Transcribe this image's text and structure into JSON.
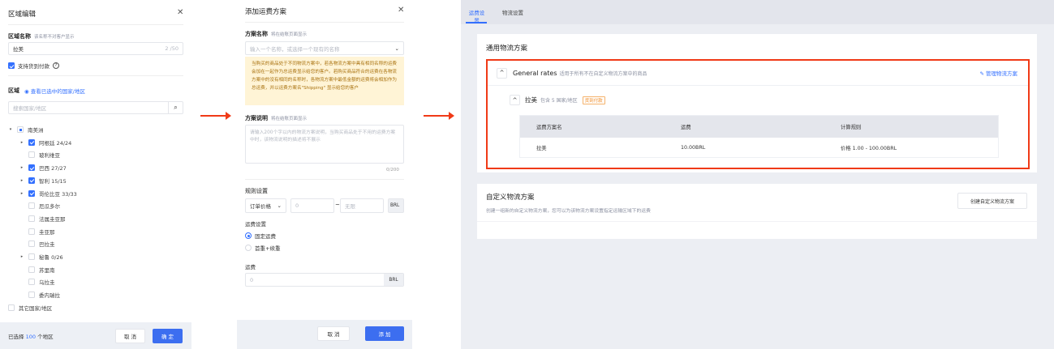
{
  "region_editor": {
    "title": "区域编辑",
    "name_label": "区域名称",
    "name_hint": "该名称不对客户显示",
    "name_value": "拉美",
    "name_counter": "2 /50",
    "cod_label": "支持货到付款",
    "region_label": "区域",
    "view_selected_link": "查看已选中的国家/地区",
    "search_placeholder": "搜索国家/地区",
    "tree": [
      {
        "label": "南美洲",
        "state": "half",
        "level": 0,
        "expand": true
      },
      {
        "label": "阿根廷 24/24",
        "state": "on",
        "level": 1,
        "expand": true
      },
      {
        "label": "玻利维亚",
        "state": "off",
        "level": 1,
        "expand": false
      },
      {
        "label": "巴西 27/27",
        "state": "on",
        "level": 1,
        "expand": true
      },
      {
        "label": "智利 15/15",
        "state": "on",
        "level": 1,
        "expand": true
      },
      {
        "label": "哥伦比亚 33/33",
        "state": "on",
        "level": 1,
        "expand": true
      },
      {
        "label": "厄瓜多尔",
        "state": "off",
        "level": 1,
        "expand": false
      },
      {
        "label": "法属圭亚那",
        "state": "off",
        "level": 1,
        "expand": false
      },
      {
        "label": "圭亚那",
        "state": "off",
        "level": 1,
        "expand": false
      },
      {
        "label": "巴拉圭",
        "state": "off",
        "level": 1,
        "expand": false
      },
      {
        "label": "秘鲁 0/26",
        "state": "off",
        "level": 1,
        "expand": true
      },
      {
        "label": "苏里南",
        "state": "off",
        "level": 1,
        "expand": false
      },
      {
        "label": "乌拉圭",
        "state": "off",
        "level": 1,
        "expand": false
      },
      {
        "label": "委内瑞拉",
        "state": "off",
        "level": 1,
        "expand": false
      },
      {
        "label": "其它国家/地区",
        "state": "off",
        "level": 0,
        "expand": false
      }
    ],
    "footer_prefix": "已选择",
    "footer_count": "100",
    "footer_suffix": "个地区",
    "cancel": "取 消",
    "confirm": "确 定"
  },
  "add_rate": {
    "title": "添加运费方案",
    "name_label": "方案名称",
    "name_hint": "将在结账页面显示",
    "name_placeholder": "输入一个名称，或选择一个现有的名称",
    "warning": "当购买的商品处于不同物流方案中，若各物流方案中具有相同名称的运费会加在一起作为总运费显示给您的客户。若购买商品符合的运费在各物流方案中的没有相同的名称时，各物流方案中最低金额的运费将会相加作为总运费，并以运费方案名\"Shipping\" 显示给您的客户",
    "desc_label": "方案说明",
    "desc_hint": "将在结账页面显示",
    "desc_placeholder": "请输入200个字以内的物流方案说明，当购买商品处于不用的运费方案中时，该物流说明的描述将不展示",
    "desc_counter": "0/200",
    "rule_label": "规则设置",
    "rule_type": "订单价格",
    "rule_min_placeholder": "0",
    "rule_sep": "~",
    "rule_max_placeholder": "无限",
    "currency": "BRL",
    "fee_setting_label": "运费设置",
    "fee_options": [
      "固定运费",
      "首重+续重"
    ],
    "fee_label": "运费",
    "fee_placeholder": "0",
    "cancel": "取 消",
    "add": "添 加"
  },
  "settings": {
    "tabs": [
      "运费设置",
      "物流设置"
    ],
    "general_title": "通用物流方案",
    "general_rates": "General rates",
    "general_desc": "适用于所有不在自定义物流方案中的商品",
    "manage_link": "管理物流方案",
    "zone_name": "拉美",
    "zone_desc": "包含 5 国家/地区",
    "zone_tag": "货到付款",
    "table_headers": [
      "运费方案名",
      "运费",
      "计算规则"
    ],
    "table_rows": [
      [
        "拉美",
        "10.00BRL",
        "价格 1.00 - 100.00BRL"
      ]
    ],
    "custom_title": "自定义物流方案",
    "custom_desc": "创建一组新的自定义物流方案，您可以为该物流方案设置指定运输区域下的运费",
    "create_button": "创建自定义物流方案"
  },
  "colors": {
    "accent": "#3370ff",
    "highlight": "#f03a17",
    "warning_bg": "#fff4d6"
  }
}
